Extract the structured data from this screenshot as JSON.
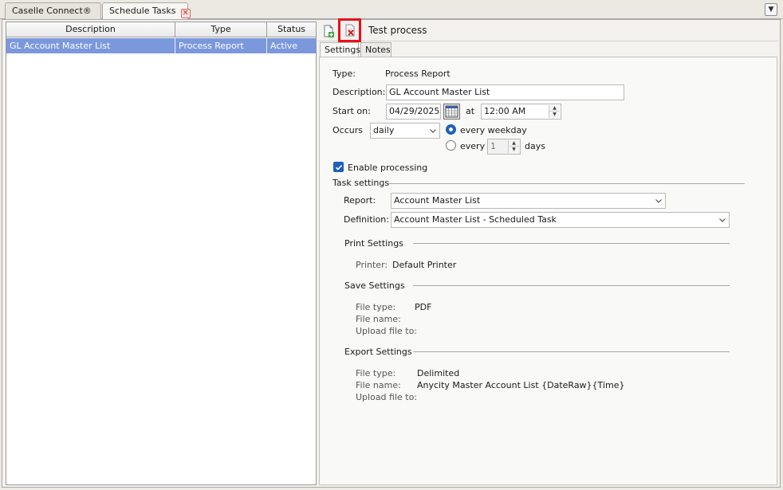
{
  "tabs": [
    {
      "label": "Caselle Connect®"
    },
    {
      "label": "Schedule Tasks"
    }
  ],
  "grid": {
    "columns": [
      "Description",
      "Type",
      "Status"
    ],
    "rows": [
      {
        "description": "GL Account Master List",
        "type": "Process Report",
        "status": "Active"
      }
    ]
  },
  "toolbar": {
    "new_icon": "new-document-icon",
    "test_icon": "test-process-icon",
    "title": "Test process"
  },
  "subtabs": [
    "Settings",
    "Notes"
  ],
  "settings": {
    "type_label": "Type:",
    "type_value": "Process Report",
    "description_label": "Description:",
    "description_value": "GL Account Master List",
    "start_label": "Start on:",
    "start_date": "04/29/2025",
    "at_label": "at",
    "start_time": "12:00 AM",
    "occurs_label": "Occurs",
    "occurs_value": "daily",
    "option_weekday": "every weekday",
    "option_every": "every",
    "every_days_value": "1",
    "days_label": "days",
    "enable_label": "Enable processing",
    "enable_checked": true
  },
  "task_settings": {
    "heading": "Task settings",
    "report_label": "Report:",
    "report_value": "Account Master List",
    "definition_label": "Definition:",
    "definition_value": "Account Master List - Scheduled Task"
  },
  "print_settings": {
    "heading": "Print Settings",
    "printer_label": "Printer:",
    "printer_value": "Default Printer"
  },
  "save_settings": {
    "heading": "Save Settings",
    "file_type_label": "File type:",
    "file_type_value": "PDF",
    "file_name_label": "File name:",
    "upload_label": "Upload file to:"
  },
  "export_settings": {
    "heading": "Export Settings",
    "file_type_label": "File type:",
    "file_type_value": "Delimited",
    "file_name_label": "File name:",
    "file_name_value": "Anycity Master Account List {DateRaw}{Time}",
    "upload_label": "Upload file to:"
  },
  "colors": {
    "selection": "#7b98dc",
    "accent": "#1f5fbf",
    "highlight_border": "#e8101a"
  }
}
